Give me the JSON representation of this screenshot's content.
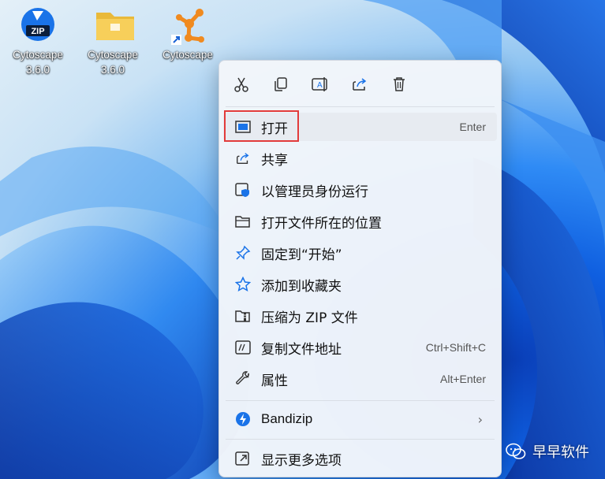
{
  "desktop": {
    "icons": [
      {
        "label_line1": "Cytoscape",
        "label_line2": "3.6.0",
        "badge": "ZIP",
        "icon": "bandizip-archive-icon"
      },
      {
        "label_line1": "Cytoscape",
        "label_line2": "3.6.0",
        "icon": "folder-icon"
      },
      {
        "label_line1": "Cytoscape",
        "icon": "cytoscape-shortcut-icon"
      }
    ]
  },
  "menu": {
    "toolbar": [
      "cut-icon",
      "copy-icon",
      "rename-icon",
      "share-icon",
      "delete-icon"
    ],
    "items": [
      {
        "label": "打开",
        "shortcut": "Enter",
        "icon": "open-window-icon"
      },
      {
        "label": "共享",
        "shortcut": "",
        "icon": "share-icon"
      },
      {
        "label": "以管理员身份运行",
        "shortcut": "",
        "icon": "run-as-admin-icon"
      },
      {
        "label": "打开文件所在的位置",
        "shortcut": "",
        "icon": "folder-open-icon"
      },
      {
        "label": "固定到“开始”",
        "shortcut": "",
        "icon": "pin-icon"
      },
      {
        "label": "添加到收藏夹",
        "shortcut": "",
        "icon": "star-icon"
      },
      {
        "label": "压缩为 ZIP 文件",
        "shortcut": "",
        "icon": "zip-folder-icon"
      },
      {
        "label": "复制文件地址",
        "shortcut": "Ctrl+Shift+C",
        "icon": "copy-path-icon"
      },
      {
        "label": "属性",
        "shortcut": "Alt+Enter",
        "icon": "wrench-icon"
      },
      {
        "label": "Bandizip",
        "shortcut": "",
        "icon": "bandizip-icon"
      },
      {
        "label": "显示更多选项",
        "shortcut": "",
        "icon": "more-options-icon"
      }
    ],
    "chevron": "›"
  },
  "watermark": {
    "text": "早早软件",
    "icon": "wechat-icon"
  },
  "colors": {
    "highlight_box": "#e23b3b",
    "accent": "#1a73e8"
  }
}
